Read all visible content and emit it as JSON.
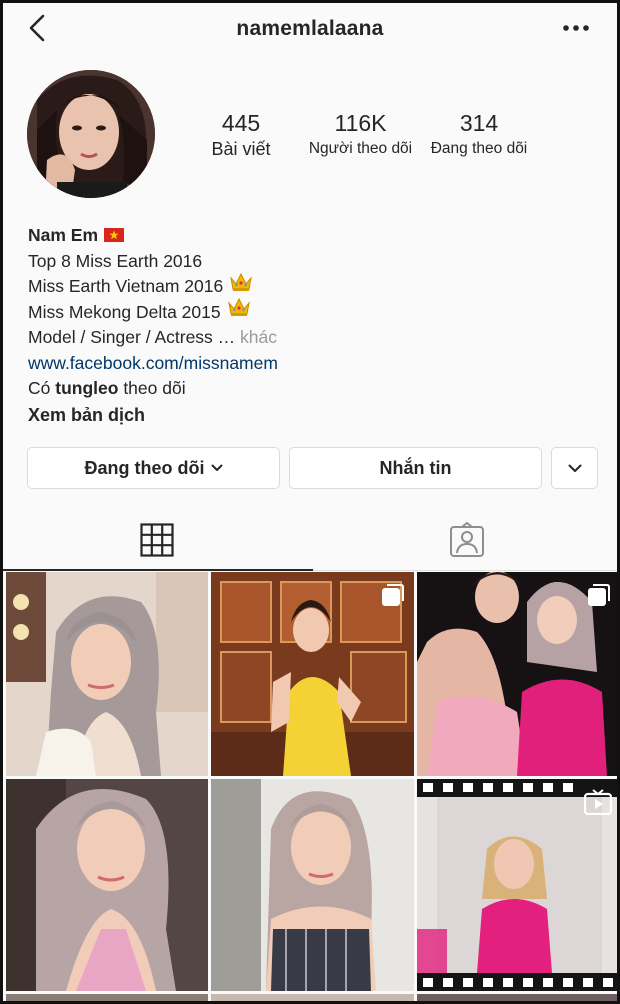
{
  "header": {
    "username": "namemlalaana"
  },
  "profile": {
    "stats": [
      {
        "value": "445",
        "label": "Bài viết"
      },
      {
        "value": "116K",
        "label": "Người theo dõi"
      },
      {
        "value": "314",
        "label": "Đang theo dõi"
      }
    ]
  },
  "bio": {
    "name": "Nam Em",
    "line1": "Top 8 Miss Earth 2016",
    "line2": "Miss Earth Vietnam 2016",
    "line3": "Miss Mekong Delta 2015",
    "line4": "Model / Singer / Actress …",
    "line4_more": "khác",
    "link": "www.facebook.com/missnamem",
    "followed_prefix": "Có",
    "followed_user": "tungleo",
    "followed_suffix": "theo dõi",
    "translate": "Xem bản dịch"
  },
  "actions": {
    "following_label": "Đang theo dõi",
    "message_label": "Nhắn tin"
  },
  "tabs": {
    "active": "grid"
  },
  "icons": {
    "back": "chevron-left-icon",
    "more": "more-horizontal-icon",
    "grid": "grid-icon",
    "tagged": "tagged-person-icon",
    "multi": "carousel-icon",
    "igtv": "igtv-icon",
    "flag": "vietnam-flag-icon",
    "crown": "crown-icon"
  },
  "colors": {
    "text": "#262626",
    "link": "#00376b",
    "muted": "#9a9a9a",
    "border": "#dbdbdb"
  }
}
